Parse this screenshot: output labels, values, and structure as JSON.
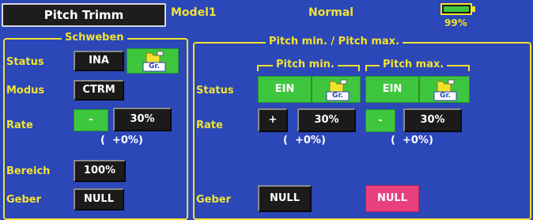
{
  "header": {
    "screen_title": "Pitch Trimm",
    "model": "Model1",
    "condition": "Normal",
    "battery_percent": "99%",
    "battery_level": 0.99
  },
  "schweben": {
    "title": "Schweben",
    "status_label": "Status",
    "status_value": "INA",
    "group_label": "Gr.",
    "modus_label": "Modus",
    "modus_value": "CTRM",
    "rate_label": "Rate",
    "rate_sign": "-",
    "rate_value": "30%",
    "rate_offset": "(  +0%)",
    "bereich_label": "Bereich",
    "bereich_value": "100%",
    "geber_label": "Geber",
    "geber_value": "NULL"
  },
  "pitch": {
    "title": "Pitch min. / Pitch max.",
    "min_title": "Pitch min.",
    "max_title": "Pitch max.",
    "status_label": "Status",
    "rate_label": "Rate",
    "geber_label": "Geber",
    "min_status": "EIN",
    "max_status": "EIN",
    "group_label": "Gr.",
    "min_sign": "+",
    "min_rate": "30%",
    "min_offset": "(  +0%)",
    "max_sign": "-",
    "max_rate": "30%",
    "max_offset": "(  +0%)",
    "min_geber": "NULL",
    "max_geber": "NULL"
  },
  "colors": {
    "background": "#2b47b8",
    "label": "#f2e230",
    "active_green": "#3fc63f",
    "highlight_pink": "#e8407e"
  }
}
